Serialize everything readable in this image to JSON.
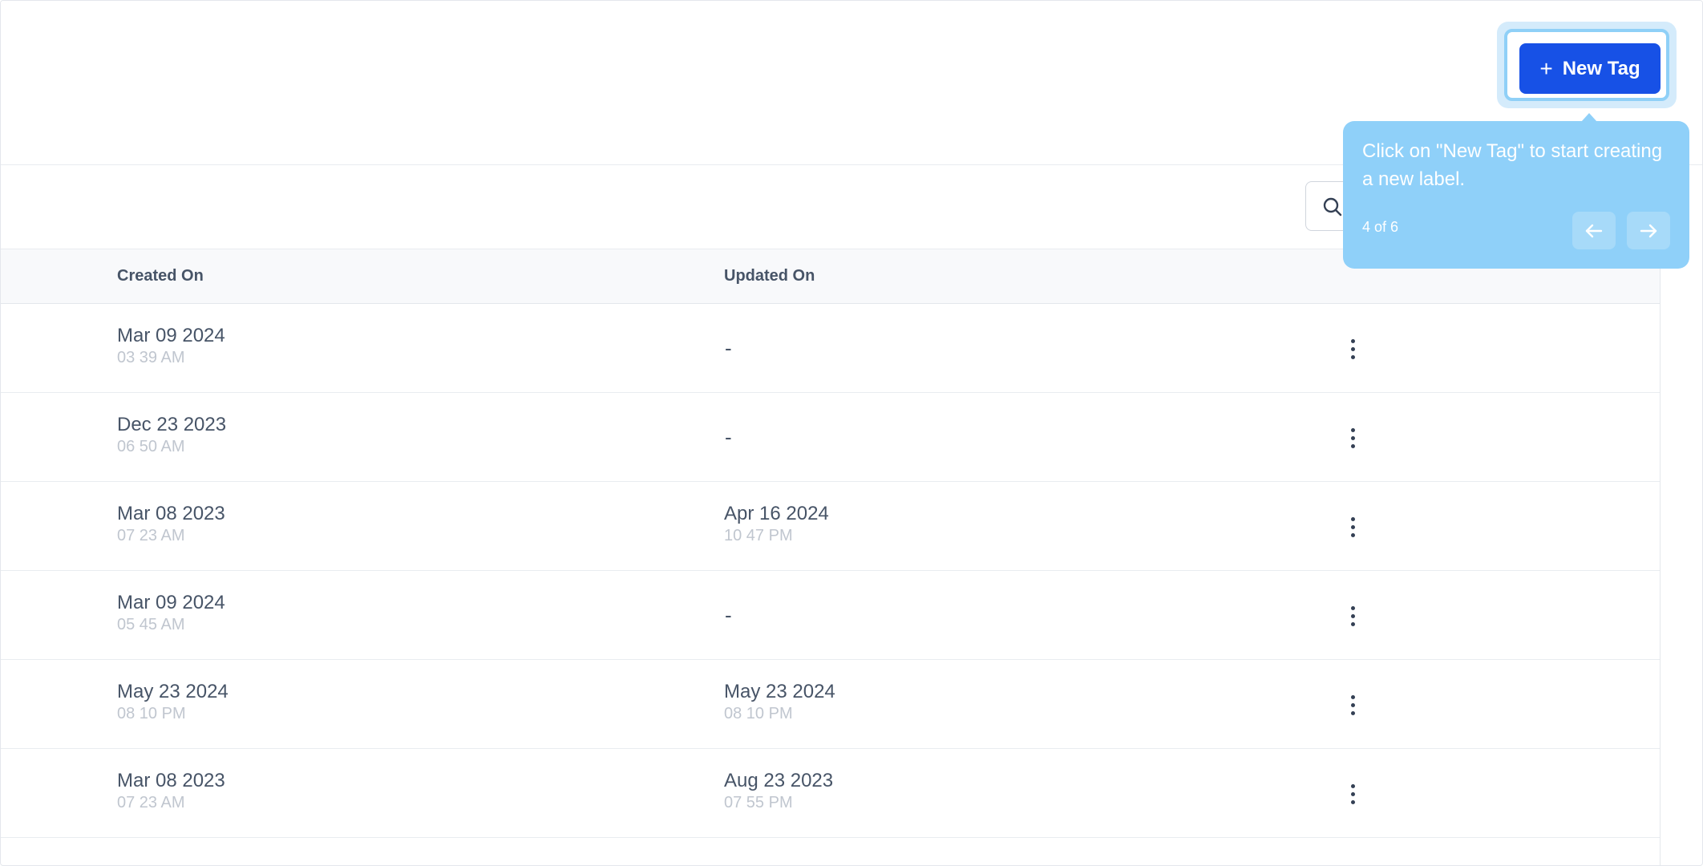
{
  "header": {
    "new_tag_label": "New Tag"
  },
  "search": {
    "placeholder": ""
  },
  "table": {
    "columns": [
      "Created On",
      "Updated On"
    ],
    "rows": [
      {
        "created_date": "Mar 09 2024",
        "created_time": "03 39 AM",
        "updated_date": "-",
        "updated_time": ""
      },
      {
        "created_date": "Dec 23 2023",
        "created_time": "06 50 AM",
        "updated_date": "-",
        "updated_time": ""
      },
      {
        "created_date": "Mar 08 2023",
        "created_time": "07 23 AM",
        "updated_date": "Apr 16 2024",
        "updated_time": "10 47 PM"
      },
      {
        "created_date": "Mar 09 2024",
        "created_time": "05 45 AM",
        "updated_date": "-",
        "updated_time": ""
      },
      {
        "created_date": "May 23 2024",
        "created_time": "08 10 PM",
        "updated_date": "May 23 2024",
        "updated_time": "08 10 PM"
      },
      {
        "created_date": "Mar 08 2023",
        "created_time": "07 23 AM",
        "updated_date": "Aug 23 2023",
        "updated_time": "07 55 PM"
      }
    ]
  },
  "tooltip": {
    "text": "Click on \"New Tag\" to start creating a new label.",
    "step": "4 of 6"
  },
  "colors": {
    "primary": "#1751e6",
    "tooltip_bg": "#8fd0f9",
    "highlight_ring": "#8fd0f7"
  },
  "icons": {
    "new_tag": "plus-icon",
    "search": "search-icon",
    "row_actions": "kebab-menu-icon",
    "prev": "arrow-left-icon",
    "next": "arrow-right-icon"
  }
}
